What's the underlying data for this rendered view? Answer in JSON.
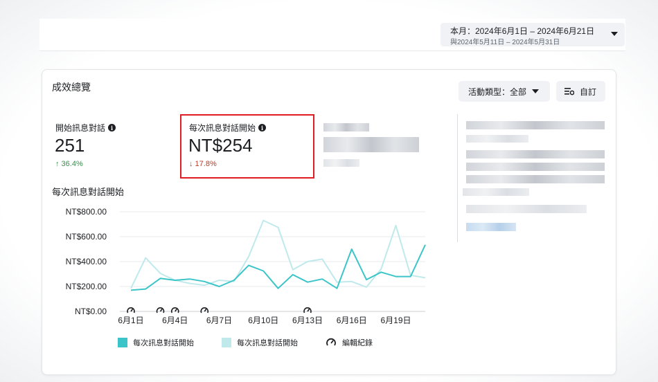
{
  "header": {
    "date_range_main": "本月：2024年6月1日 – 2024年6月21日",
    "date_range_compare": "與2024年5月11日 – 2024年5月31日"
  },
  "card": {
    "title": "成效總覽",
    "type_filter_label": "活動類型：全部",
    "custom_label": "自訂"
  },
  "metrics": [
    {
      "label": "開始訊息對話",
      "value": "251",
      "change": "↑ 36.4%",
      "direction": "up"
    },
    {
      "label": "每次訊息對話開始",
      "value": "NT$254",
      "change": "↓ 17.8%",
      "direction": "down"
    }
  ],
  "colors": {
    "series_current": "#3cc5c8",
    "series_compare": "#bfe9eb",
    "highlight_box": "#e01b22",
    "change_up": "#3a8e4f",
    "change_down": "#b0402c"
  },
  "chart_data": {
    "type": "line",
    "title": "每次訊息對話開始",
    "y_ticks": [
      "NT$800.00",
      "NT$600.00",
      "NT$400.00",
      "NT$200.00",
      "NT$0.00"
    ],
    "ylim": [
      0,
      800
    ],
    "x_tick_labels": [
      "6月1日",
      "6月4日",
      "6月7日",
      "6月10日",
      "6月13日",
      "6月16日",
      "6月19日"
    ],
    "x_tick_days": [
      1,
      4,
      7,
      10,
      13,
      16,
      19
    ],
    "x_days": [
      1,
      2,
      3,
      4,
      5,
      6,
      7,
      8,
      9,
      10,
      11,
      12,
      13,
      14,
      15,
      16,
      17,
      18,
      19,
      20,
      21
    ],
    "series": [
      {
        "name": "每次訊息對話開始",
        "values": [
          170,
          180,
          265,
          250,
          260,
          240,
          200,
          250,
          370,
          325,
          185,
          295,
          235,
          260,
          185,
          500,
          255,
          315,
          280,
          280,
          535
        ]
      },
      {
        "name": "每次訊息對話開始",
        "values": [
          185,
          430,
          305,
          250,
          225,
          210,
          250,
          240,
          440,
          730,
          675,
          335,
          400,
          420,
          235,
          240,
          195,
          340,
          690,
          290,
          270
        ]
      }
    ],
    "edit_markers_days": [
      1,
      3,
      4,
      6,
      13
    ],
    "legend_edit_label": "編輯紀錄",
    "grid": true,
    "legend_position": "bottom"
  }
}
